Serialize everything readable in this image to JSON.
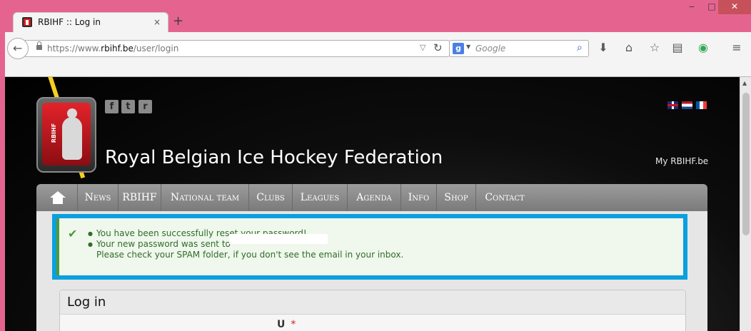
{
  "browser": {
    "tab_title": "RBIHF :: Log in",
    "tab_close": "×",
    "new_tab": "+",
    "url_prefix": "https://www.",
    "url_domain": "rbihf.be",
    "url_path": "/user/login",
    "search_placeholder": "Google",
    "search_engine_letter": "g",
    "window_controls": {
      "minimize": "‒",
      "maximize": "□",
      "close": "✕"
    },
    "icons": [
      "back-icon",
      "lock-icon",
      "dropdown-icon",
      "reload-icon",
      "magnifier-icon",
      "download-icon",
      "home-icon",
      "bookmark-star-icon",
      "reading-list-icon",
      "extension-icon",
      "hamburger-menu-icon"
    ]
  },
  "site": {
    "logo_text": "RBIHF",
    "title": "Royal Belgian Ice Hockey Federation",
    "social": {
      "facebook": "f",
      "twitter": "t",
      "rss": "r"
    },
    "my_link": "My RBIHF.be",
    "flags": [
      "uk-flag",
      "nl-flag",
      "fr-flag"
    ],
    "colors": {
      "accent_yellow": "#f3d01f",
      "alert_border": "#0aa0e0",
      "alert_green": "#4f9a3a",
      "logo_red": "#e3232a"
    }
  },
  "menu": {
    "items": [
      "News",
      "RBIHF",
      "National team",
      "Clubs",
      "Leagues",
      "Agenda",
      "Info",
      "Shop",
      "Contact"
    ]
  },
  "alert": {
    "line1": "You have been successfully reset your password!",
    "line2": "Your new password was sent to",
    "line3": "Please check your SPAM folder, if you don't see the email in your inbox."
  },
  "login": {
    "title": "Log in",
    "field_fragment": "U",
    "required_mark": "*"
  }
}
